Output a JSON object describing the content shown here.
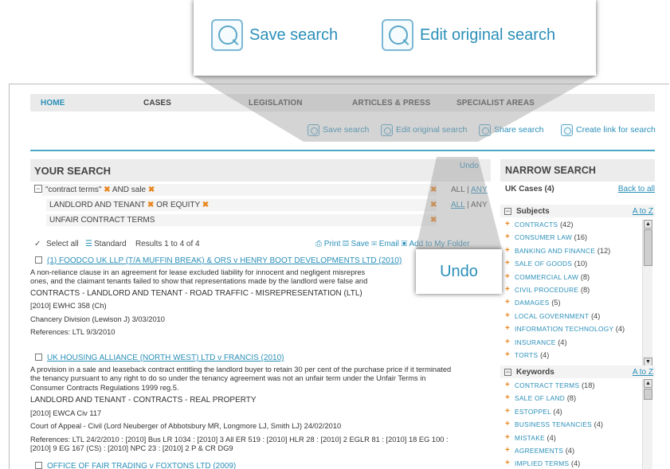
{
  "zoom_tools": {
    "save_label": "Save search",
    "edit_label": "Edit original search"
  },
  "zoom_undo": {
    "label": "Undo"
  },
  "nav": {
    "items": [
      "HOME",
      "CASES",
      "LEGISLATION",
      "ARTICLES & PRESS",
      "SPECIALIST AREAS"
    ]
  },
  "toolbar": {
    "save_label": "Save search",
    "edit_label": "Edit original search",
    "share_label": "Share search",
    "link_label": "Create link for search"
  },
  "your_search": {
    "heading": "YOUR SEARCH",
    "undo": "Undo",
    "q1_a": "\"contract terms\"",
    "q1_and": "AND",
    "q1_b": "sale",
    "q2_a": "LANDLORD AND TENANT",
    "q2_or": "OR",
    "q2_b": "EQUITY",
    "q3_a": "UNFAIR CONTRACT TERMS",
    "all_any_1_all": "ALL",
    "all_any_1_sep": "|",
    "all_any_1_any": "ANY",
    "all_any_2_all": "ALL",
    "all_any_2_sep": "|",
    "all_any_2_any": "ANY",
    "remove_glyph": "✖"
  },
  "results_bar": {
    "select_all": "Select all",
    "standard": "Standard",
    "count": "Results 1 to 4 of 4",
    "print": "Print",
    "save": "Save",
    "email": "Email",
    "folder": "Add to My Folder"
  },
  "results": [
    {
      "title": "(1) FOODCO UK LLP (T/A MUFFIN BREAK) & ORS v HENRY BOOT DEVELOPMENTS LTD (2010)",
      "summary": "A non-reliance clause in an agreement for lease excluded liability for innocent and negligent misrepres",
      "summary2": "ones, and the claimant tenants failed to show that representations made by the landlord were false and",
      "subjects": "CONTRACTS - LANDLORD AND TENANT - ROAD TRAFFIC - MISREPRESENTATION (LTL)",
      "citation": "[2010] EWHC 358 (Ch)",
      "court": "Chancery Division (Lewison J) 3/03/2010",
      "refs": "References: LTL 9/3/2010"
    },
    {
      "title": "UK HOUSING ALLIANCE (NORTH WEST) LTD v FRANCIS (2010)",
      "summary": "A provision in a sale and leaseback contract entitling the landlord buyer to retain 30 per cent of the purchase price if it terminated",
      "summary2": "the tenancy pursuant to any right to do so under the tenancy agreement was not an unfair term under the Unfair Terms in",
      "summary3": "Consumer Contracts Regulations 1999 reg.5.",
      "subjects": "LANDLORD AND TENANT - CONTRACTS - REAL PROPERTY",
      "citation": "[2010] EWCA Civ 117",
      "court": "Court of Appeal - Civil (Lord Neuberger of Abbotsbury MR, Longmore LJ, Smith LJ) 24/02/2010",
      "refs": "References: LTL 24/2/2010 : [2010] Bus LR 1034 : [2010] 3 All ER 519 : [2010] HLR 28 : [2010] 2 EGLR 81 : [2010] 18 EG 100 :",
      "refs2": "[2010] 9 EG 167 (CS) : [2010] NPC 23 : [2010] 2 P & CR DG9"
    },
    {
      "title": "OFFICE OF FAIR TRADING v FOXTONS LTD (2009)"
    }
  ],
  "narrow": {
    "heading": "NARROW SEARCH",
    "scope": "UK Cases (4)",
    "back": "Back to all",
    "subjects_title": "Subjects",
    "keywords_title": "Keywords",
    "atoz": "A to Z",
    "subjects": [
      {
        "label": "CONTRACTS",
        "count": "(42)"
      },
      {
        "label": "CONSUMER LAW",
        "count": "(16)"
      },
      {
        "label": "BANKING AND FINANCE",
        "count": "(12)"
      },
      {
        "label": "SALE OF GOODS",
        "count": "(10)"
      },
      {
        "label": "COMMERCIAL LAW",
        "count": "(8)"
      },
      {
        "label": "CIVIL PROCEDURE",
        "count": "(8)"
      },
      {
        "label": "DAMAGES",
        "count": "(5)"
      },
      {
        "label": "LOCAL GOVERNMENT",
        "count": "(4)"
      },
      {
        "label": "INFORMATION TECHNOLOGY",
        "count": "(4)"
      },
      {
        "label": "INSURANCE",
        "count": "(4)"
      },
      {
        "label": "TORTS",
        "count": "(4)"
      }
    ],
    "keywords": [
      {
        "label": "CONTRACT TERMS",
        "count": "(18)"
      },
      {
        "label": "SALE OF LAND",
        "count": "(8)"
      },
      {
        "label": "ESTOPPEL",
        "count": "(4)"
      },
      {
        "label": "BUSINESS TENANCIES",
        "count": "(4)"
      },
      {
        "label": "MISTAKE",
        "count": "(4)"
      },
      {
        "label": "AGREEMENTS",
        "count": "(4)"
      },
      {
        "label": "IMPLIED TERMS",
        "count": "(4)"
      }
    ]
  },
  "colors": {
    "accent": "#2a8fb8",
    "remove": "#e8861f",
    "rule": "#4aaac5"
  }
}
